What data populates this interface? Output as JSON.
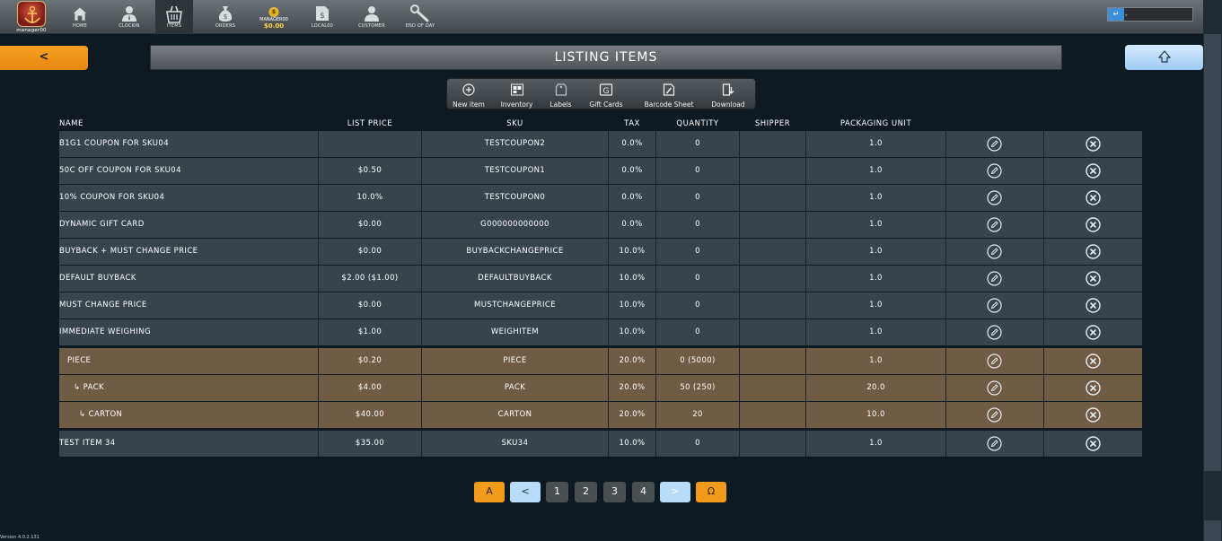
{
  "user": {
    "name": "manager00"
  },
  "nav": [
    {
      "label": "HOME",
      "icon": "home-icon"
    },
    {
      "label": "CLOCKIN",
      "icon": "person-icon"
    },
    {
      "label": "ITEMS",
      "icon": "basket-icon"
    },
    {
      "label": "ORDERS",
      "icon": "money-bag-icon"
    },
    {
      "label": "MANAGER00",
      "amount": "$0.00",
      "icon": "coin-icon"
    },
    {
      "label": "LOCAL00",
      "icon": "local-doc-icon"
    },
    {
      "label": "CUSTOMER",
      "icon": "customer-icon"
    },
    {
      "label": "END OF DAY",
      "icon": "wrench-icon"
    }
  ],
  "search": {
    "enter": "↵",
    "value": "-"
  },
  "page": {
    "title": "LISTING ITEMS",
    "back": "<",
    "up": "⇧"
  },
  "toolbar": [
    {
      "label": "New item",
      "icon": "plus-circle-icon"
    },
    {
      "label": "Inventory",
      "icon": "inventory-icon"
    },
    {
      "label": "Labels",
      "icon": "labels-icon"
    },
    {
      "label": "Gift Cards",
      "icon": "gift-card-icon"
    },
    {
      "label": "Barcode Sheet",
      "icon": "barcode-sheet-icon"
    },
    {
      "label": "Download",
      "icon": "download-icon"
    }
  ],
  "columns": [
    "NAME",
    "LIST PRICE",
    "SKU",
    "TAX",
    "QUANTITY",
    "SHIPPER",
    "PACKAGING UNIT"
  ],
  "rows": [
    {
      "name": "B1G1 COUPON FOR SKU04",
      "price": "",
      "sku": "TESTCOUPON2",
      "tax": "0.0%",
      "qty": "0",
      "shipper": "",
      "unit": "1.0",
      "style": "normal"
    },
    {
      "name": "50C OFF COUPON FOR SKU04",
      "price": "$0.50",
      "sku": "TESTCOUPON1",
      "tax": "0.0%",
      "qty": "0",
      "shipper": "",
      "unit": "1.0",
      "style": "normal"
    },
    {
      "name": "10% COUPON FOR SKU04",
      "price": "10.0%",
      "sku": "TESTCOUPON0",
      "tax": "0.0%",
      "qty": "0",
      "shipper": "",
      "unit": "1.0",
      "style": "normal"
    },
    {
      "name": "DYNAMIC GIFT CARD",
      "price": "$0.00",
      "sku": "G000000000000",
      "tax": "0.0%",
      "qty": "0",
      "shipper": "",
      "unit": "1.0",
      "style": "normal"
    },
    {
      "name": "BUYBACK + MUST CHANGE PRICE",
      "price": "$0.00",
      "sku": "BUYBACKCHANGEPRICE",
      "tax": "10.0%",
      "qty": "0",
      "shipper": "",
      "unit": "1.0",
      "style": "normal"
    },
    {
      "name": "DEFAULT BUYBACK",
      "price": "$2.00 ($1.00)",
      "sku": "DEFAULTBUYBACK",
      "tax": "10.0%",
      "qty": "0",
      "shipper": "",
      "unit": "1.0",
      "style": "normal"
    },
    {
      "name": "MUST CHANGE PRICE",
      "price": "$0.00",
      "sku": "MUSTCHANGEPRICE",
      "tax": "10.0%",
      "qty": "0",
      "shipper": "",
      "unit": "1.0",
      "style": "normal"
    },
    {
      "name": "IMMEDIATE WEIGHING",
      "price": "$1.00",
      "sku": "WEIGHITEM",
      "tax": "10.0%",
      "qty": "0",
      "shipper": "",
      "unit": "1.0",
      "style": "normal"
    },
    {
      "name": "PIECE",
      "price": "$0.20",
      "sku": "PIECE",
      "tax": "20.0%",
      "qty": "0 (5000)",
      "shipper": "",
      "unit": "1.0",
      "style": "brown"
    },
    {
      "name": "↳ PACK",
      "price": "$4.00",
      "sku": "PACK",
      "tax": "20.0%",
      "qty": "50 (250)",
      "shipper": "",
      "unit": "20.0",
      "style": "brown"
    },
    {
      "name": "↳ CARTON",
      "price": "$40.00",
      "sku": "CARTON",
      "tax": "20.0%",
      "qty": "20",
      "shipper": "",
      "unit": "10.0",
      "style": "brown"
    },
    {
      "name": "TEST ITEM 34",
      "price": "$35.00",
      "sku": "SKU34",
      "tax": "10.0%",
      "qty": "0",
      "shipper": "",
      "unit": "1.0",
      "style": "normal"
    }
  ],
  "pagination": {
    "first": "A",
    "prev": "<",
    "pages": [
      "1",
      "2",
      "3",
      "4"
    ],
    "next": ">",
    "last": "Ω"
  },
  "version": "Version 4.0.2.131",
  "colors": {
    "orange": "#f29a1c",
    "light_blue": "#b6dcf7",
    "row": "#38444c",
    "row_brown": "#705b44",
    "background": "#0d1a21"
  }
}
